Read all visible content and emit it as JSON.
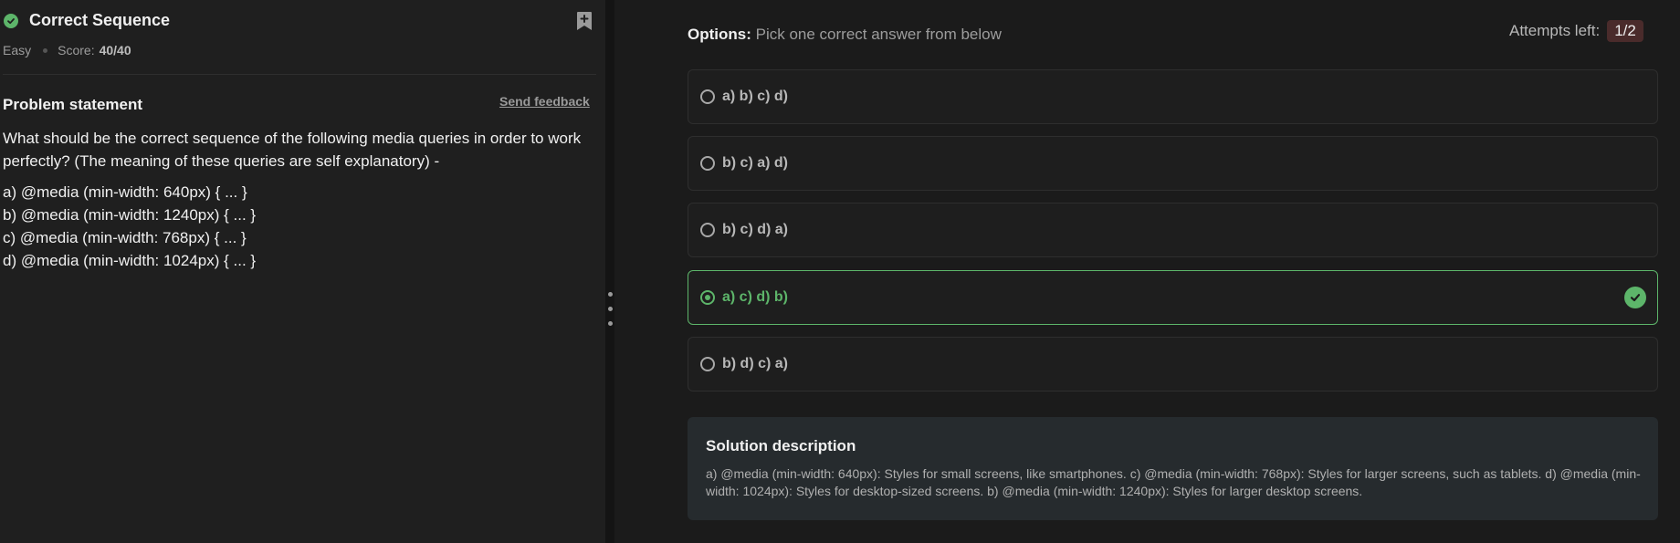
{
  "problem": {
    "title": "Correct Sequence",
    "difficulty": "Easy",
    "score_label": "Score:",
    "score_value": "40/40",
    "statement_heading": "Problem statement",
    "feedback_link": "Send feedback",
    "statement": "What should be the correct sequence of the following media queries in order to work perfectly? (The meaning of these queries are self explanatory) -",
    "queries": [
      "a) @media (min-width: 640px) { ... }",
      "b) @media (min-width: 1240px) { ... }",
      "c) @media (min-width: 768px) { ... }",
      "d) @media (min-width: 1024px) { ... }"
    ]
  },
  "options_header": {
    "label": "Options:",
    "hint": "Pick one correct answer from below"
  },
  "attempts": {
    "label": "Attempts left:",
    "value": "1/2"
  },
  "options": [
    {
      "label": "a) b) c) d)",
      "selected": false
    },
    {
      "label": "b) c) a) d)",
      "selected": false
    },
    {
      "label": "b) c) d) a)",
      "selected": false
    },
    {
      "label": "a) c) d) b)",
      "selected": true,
      "correct": true
    },
    {
      "label": "b) d) c) a)",
      "selected": false
    }
  ],
  "solution": {
    "title": "Solution description",
    "text": "a) @media (min-width: 640px): Styles for small screens, like smartphones. c) @media (min-width: 768px): Styles for larger screens, such as tablets. d) @media (min-width: 1024px): Styles for desktop-sized screens. b) @media (min-width: 1240px): Styles for larger desktop screens."
  },
  "colors": {
    "accent_green": "#5db56a",
    "attempts_badge": "#4a2b2b",
    "solution_bg": "#262b2e"
  },
  "icons": [
    "check-circle-icon",
    "bookmark-add-icon",
    "radio-icon",
    "drag-handle-icon"
  ]
}
